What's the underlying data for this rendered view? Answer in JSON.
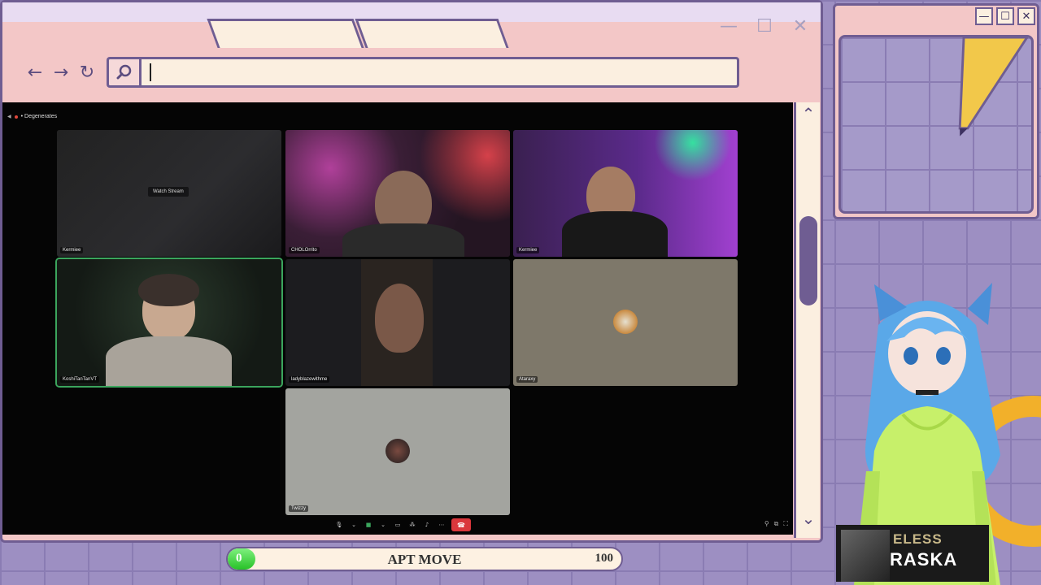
{
  "browser": {
    "url_value": "",
    "tabs": [
      "",
      ""
    ]
  },
  "discord": {
    "server_name": "• Degenerates",
    "tiles": [
      {
        "name": "Kermiee",
        "overlay": "Watch Stream"
      },
      {
        "name": "CHOLOrrito"
      },
      {
        "name": "Kermiee"
      },
      {
        "name": "KoshiTanTanVT"
      },
      {
        "name": "ladyblazewithme"
      },
      {
        "name": "Ataraxy"
      },
      {
        "name": "Twizzy"
      }
    ]
  },
  "now_playing": {
    "line1": "ELESS",
    "line2": "RASKA"
  },
  "progress": {
    "value": 0,
    "label": "APT MOVE",
    "max": 100,
    "fraction": 0.07
  },
  "colors": {
    "frame": "#6f5d92",
    "window_pink": "#f3c7c7",
    "cream": "#fbefe0",
    "progress_green": "#27c127",
    "end_call_red": "#da373c"
  }
}
